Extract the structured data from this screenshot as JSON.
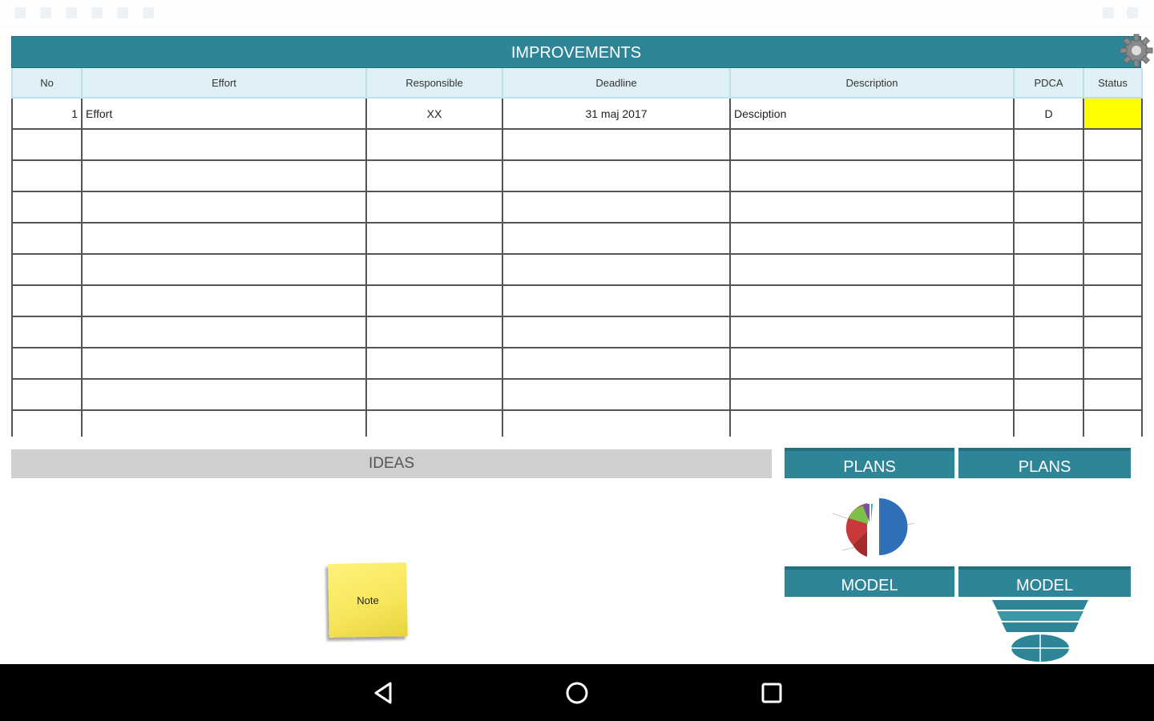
{
  "improvements": {
    "title": "IMPROVEMENTS",
    "columns": [
      "No",
      "Effort",
      "Responsible",
      "Deadline",
      "Description",
      "PDCA",
      "Status"
    ],
    "rows": [
      {
        "no": "1",
        "effort": "Effort",
        "responsible": "XX",
        "deadline": "31 maj 2017",
        "description": "Desciption",
        "pdca": "D",
        "status": "",
        "status_color": "#ffff00"
      },
      {
        "no": "",
        "effort": "",
        "responsible": "",
        "deadline": "",
        "description": "",
        "pdca": "",
        "status": ""
      },
      {
        "no": "",
        "effort": "",
        "responsible": "",
        "deadline": "",
        "description": "",
        "pdca": "",
        "status": ""
      },
      {
        "no": "",
        "effort": "",
        "responsible": "",
        "deadline": "",
        "description": "",
        "pdca": "",
        "status": ""
      },
      {
        "no": "",
        "effort": "",
        "responsible": "",
        "deadline": "",
        "description": "",
        "pdca": "",
        "status": ""
      },
      {
        "no": "",
        "effort": "",
        "responsible": "",
        "deadline": "",
        "description": "",
        "pdca": "",
        "status": ""
      },
      {
        "no": "",
        "effort": "",
        "responsible": "",
        "deadline": "",
        "description": "",
        "pdca": "",
        "status": ""
      },
      {
        "no": "",
        "effort": "",
        "responsible": "",
        "deadline": "",
        "description": "",
        "pdca": "",
        "status": ""
      },
      {
        "no": "",
        "effort": "",
        "responsible": "",
        "deadline": "",
        "description": "",
        "pdca": "",
        "status": ""
      },
      {
        "no": "",
        "effort": "",
        "responsible": "",
        "deadline": "",
        "description": "",
        "pdca": "",
        "status": ""
      },
      {
        "no": "",
        "effort": "",
        "responsible": "",
        "deadline": "",
        "description": "",
        "pdca": "",
        "status": ""
      }
    ]
  },
  "ideas": {
    "title": "IDEAS",
    "note_label": "Note"
  },
  "tiles": {
    "plans_1": "PLANS",
    "plans_2": "PLANS",
    "model_1": "MODEL",
    "model_2": "MODEL"
  },
  "icons": {
    "settings": "gear-icon",
    "nav_back": "back-triangle-icon",
    "nav_home": "home-circle-icon",
    "nav_recents": "recents-square-icon"
  },
  "colors": {
    "header_teal": "#2e8597",
    "column_header_bg": "#dff1f6",
    "status_yellow": "#ffff00",
    "ideas_bar": "#cfcfcf",
    "note_yellow": "#f7e55a"
  }
}
